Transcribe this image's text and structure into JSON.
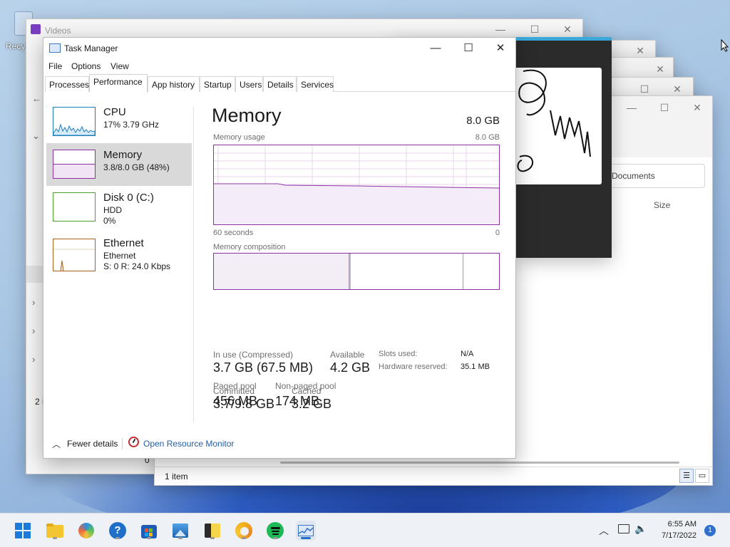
{
  "desktop": {
    "recycle_label": "Recy"
  },
  "videos_window": {
    "title": "Videos",
    "status": "2 i",
    "status2": "0"
  },
  "explorer_window": {
    "search_text": "n Documents",
    "column_size": "Size",
    "status": "1 item"
  },
  "task_manager": {
    "title": "Task Manager",
    "controls": {
      "minimize": "—",
      "maximize": "☐",
      "close": "✕"
    },
    "menu": {
      "file": "File",
      "options": "Options",
      "view": "View"
    },
    "tabs": [
      "Processes",
      "Performance",
      "App history",
      "Startup",
      "Users",
      "Details",
      "Services"
    ],
    "active_tab": "Performance",
    "sidebar": [
      {
        "name": "CPU",
        "line2": "17%  3.79 GHz",
        "line3": "",
        "color": "#1a7fbe"
      },
      {
        "name": "Memory",
        "line2": "3.8/8.0 GB (48%)",
        "line3": "",
        "color": "#8c33a4"
      },
      {
        "name": "Disk 0 (C:)",
        "line2": "HDD",
        "line3": "0%",
        "color": "#4da22b"
      },
      {
        "name": "Ethernet",
        "line2": "Ethernet",
        "line3": "S: 0  R: 24.0 Kbps",
        "color": "#a8621c"
      }
    ],
    "panel": {
      "title": "Memory",
      "total": "8.0 GB",
      "usage_label": "Memory usage",
      "usage_max": "8.0 GB",
      "time_left": "60 seconds",
      "time_right": "0",
      "composition_label": "Memory composition",
      "in_use_label": "In use (Compressed)",
      "in_use_value": "3.7 GB (67.5 MB)",
      "available_label": "Available",
      "available_value": "4.2 GB",
      "slots_label": "Slots used:",
      "slots_value": "N/A",
      "hw_label": "Hardware reserved:",
      "hw_value": "35.1 MB",
      "committed_label": "Committed",
      "committed_value": "3.7/9.8 GB",
      "cached_label": "Cached",
      "cached_value": "3.2 GB",
      "paged_label": "Paged pool",
      "paged_value": "456 MB",
      "nonpaged_label": "Non-paged pool",
      "nonpaged_value": "174 MB"
    },
    "footer": {
      "fewer_details": "Fewer details",
      "open_resource_monitor": "Open Resource Monitor"
    }
  },
  "taskbar": {
    "apps": [
      "start-icon",
      "file-explorer-icon",
      "photos-icon",
      "get-help-icon",
      "store-icon",
      "photos-app-icon",
      "sticky-notes-icon",
      "edge-icon",
      "spotify-icon",
      "task-manager-icon"
    ],
    "time": "6:55 AM",
    "date": "7/17/2022",
    "notification_count": "1"
  }
}
